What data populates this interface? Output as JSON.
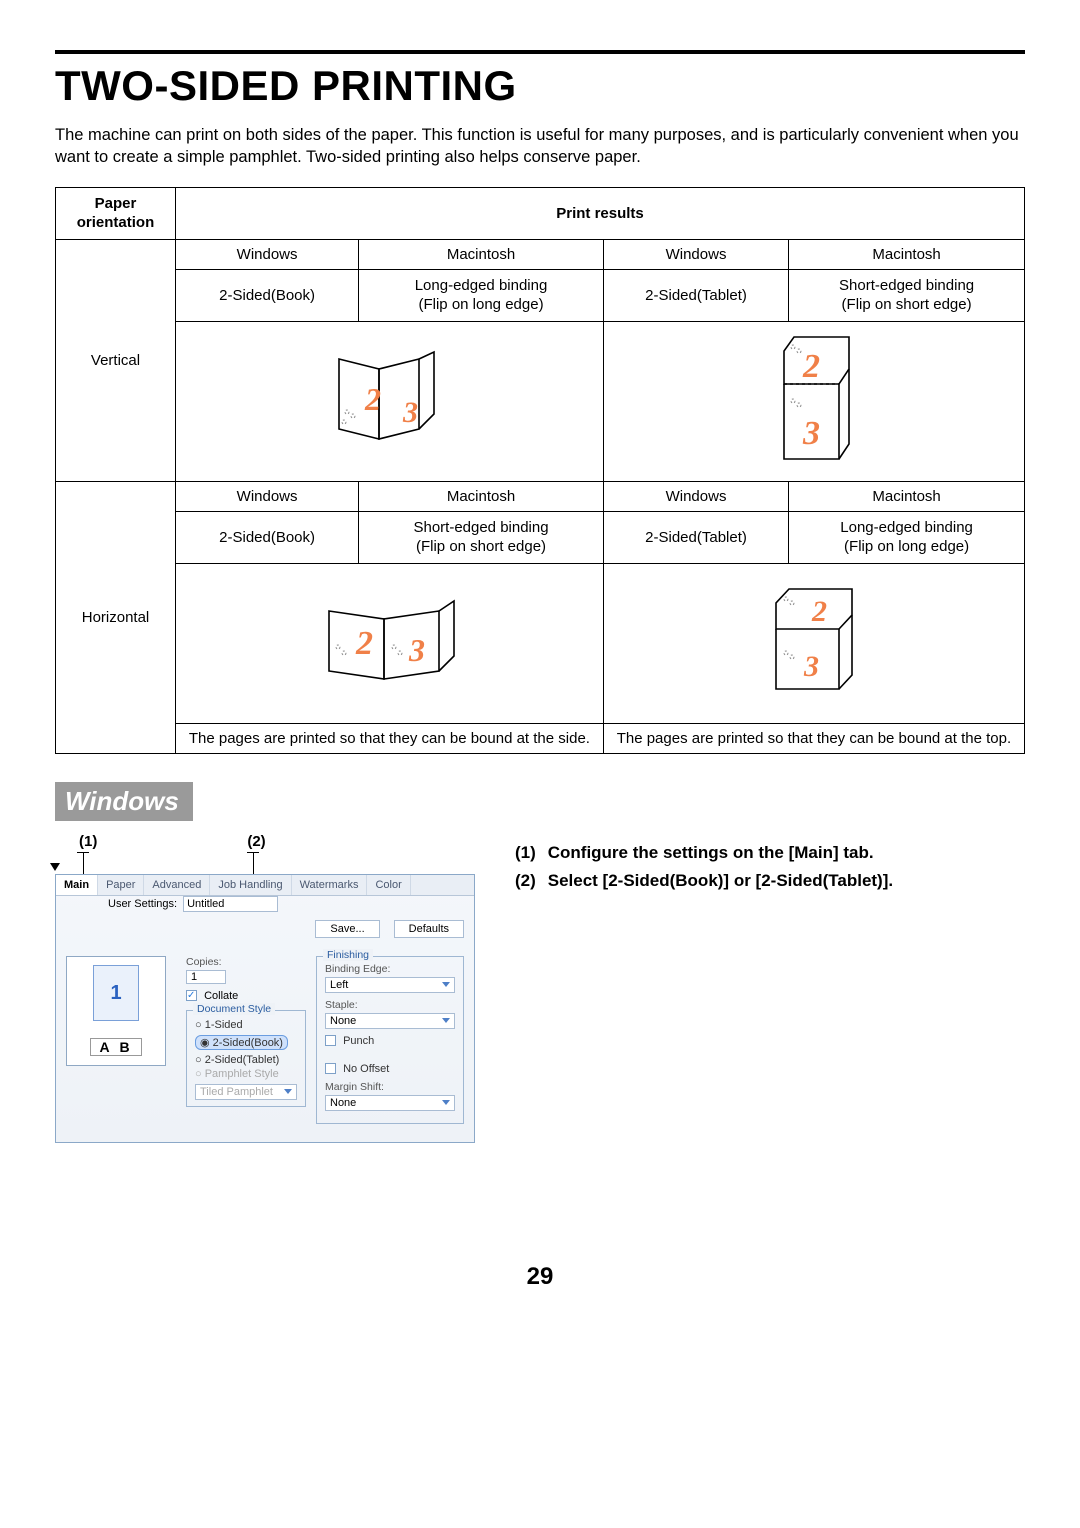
{
  "heading": "TWO-SIDED PRINTING",
  "intro": "The machine can print on both sides of the paper. This function is useful for many purposes, and is particularly convenient when you want to create a simple pamphlet. Two-sided printing also helps conserve paper.",
  "table": {
    "head": {
      "orientation": "Paper orientation",
      "results": "Print results"
    },
    "os": {
      "win": "Windows",
      "mac": "Macintosh"
    },
    "vert": {
      "label": "Vertical",
      "win_book": "2-Sided(Book)",
      "mac_book_l1": "Long-edged binding",
      "mac_book_l2": "(Flip on long edge)",
      "win_tab": "2-Sided(Tablet)",
      "mac_tab_l1": "Short-edged binding",
      "mac_tab_l2": "(Flip on short edge)"
    },
    "horiz": {
      "label": "Horizontal",
      "win_book": "2-Sided(Book)",
      "mac_book_l1": "Short-edged binding",
      "mac_book_l2": "(Flip on short edge)",
      "win_tab": "2-Sided(Tablet)",
      "mac_tab_l1": "Long-edged binding",
      "mac_tab_l2": "(Flip on long edge)"
    },
    "desc_side": "The pages are printed so that they can be bound at the side.",
    "desc_top": "The pages are printed so that they can be bound at the top."
  },
  "windows_badge": "Windows",
  "callout1": "(1)",
  "callout2": "(2)",
  "dialog": {
    "tabs": [
      "Main",
      "Paper",
      "Advanced",
      "Job Handling",
      "Watermarks",
      "Color"
    ],
    "active_tab": "Main",
    "user_settings_label": "User Settings:",
    "user_settings_value": "Untitled",
    "save_btn": "Save...",
    "defaults_btn": "Defaults",
    "copies_label": "Copies:",
    "copies_value": "1",
    "collate_label": "Collate",
    "doc_style_label": "Document Style",
    "ds_opt1": "1-Sided",
    "ds_opt2": "2-Sided(Book)",
    "ds_opt3": "2-Sided(Tablet)",
    "ds_opt4": "Pamphlet Style",
    "tiled_label": "Tiled Pamphlet",
    "finishing_label": "Finishing",
    "binding_label": "Binding Edge:",
    "binding_value": "Left",
    "staple_label": "Staple:",
    "staple_value": "None",
    "punch_label": "Punch",
    "nooffset_label": "No Offset",
    "margin_label": "Margin Shift:",
    "margin_value": "None",
    "preview_ab": "A | B",
    "preview_num": "1"
  },
  "steps": {
    "s1_num": "(1)",
    "s1_text": "Configure the settings on the [Main] tab.",
    "s2_num": "(2)",
    "s2_text": "Select [2-Sided(Book)] or [2-Sided(Tablet)]."
  },
  "page_number": "29"
}
